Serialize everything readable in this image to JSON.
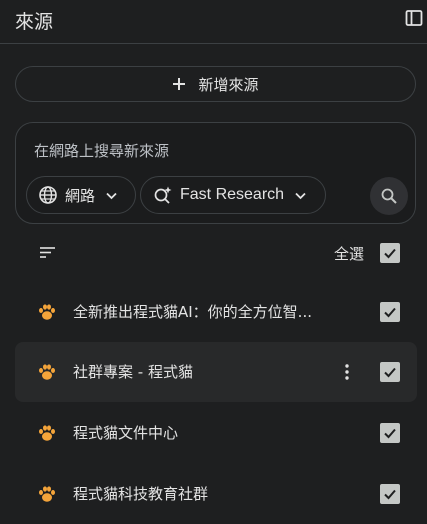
{
  "header": {
    "title": "來源",
    "panel_icon": "side-panel-icon"
  },
  "add_source": {
    "label": "新增來源",
    "icon": "plus-icon"
  },
  "search": {
    "placeholder": "在網路上搜尋新來源",
    "source_chip": {
      "label": "網路",
      "icon": "globe-icon"
    },
    "mode_chip": {
      "label": "Fast Research",
      "icon": "sparkle-search-icon"
    },
    "submit_icon": "search-icon"
  },
  "list_header": {
    "sort_icon": "sort-icon",
    "select_all_label": "全選",
    "select_all_checked": true
  },
  "sources": [
    {
      "title": "全新推出程式貓AI：你的全方位智...",
      "icon": "paw-icon",
      "checked": true
    },
    {
      "title": "社群專案 - 程式貓",
      "icon": "paw-icon",
      "checked": true,
      "highlighted": true
    },
    {
      "title": "程式貓文件中心",
      "icon": "paw-icon",
      "checked": true
    },
    {
      "title": "程式貓科技教育社群",
      "icon": "paw-icon",
      "checked": true
    }
  ],
  "colors": {
    "background": "#1e1f20",
    "border": "#3c4043",
    "text": "#e3e3e3",
    "paw": "#f4a43a",
    "checkbox": "#c4c7c5"
  }
}
